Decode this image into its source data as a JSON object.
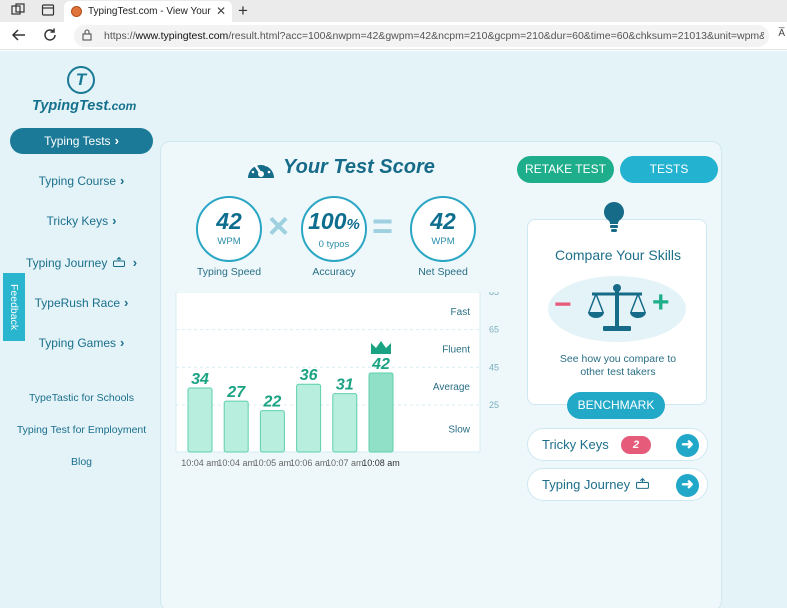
{
  "browser": {
    "tab_title": "TypingTest.com - View Your Typi",
    "tab_close": "✕",
    "new_tab": "+",
    "url_prefix": "https://",
    "url_host": "www.typingtest.com",
    "url_path": "/result.html?acc=100&nwpm=42&gwpm=42&ncpm=210&gcpm=210&dur=60&time=60&chksum=21013&unit=wpm&k...",
    "reader_icon": "A̅"
  },
  "logo": {
    "mark": "T",
    "name": "TypingTest",
    "suffix": ".com"
  },
  "sidebar": {
    "items": [
      {
        "label": "Typing Tests",
        "active": true
      },
      {
        "label": "Typing Course",
        "active": false
      },
      {
        "label": "Tricky Keys",
        "active": false
      },
      {
        "label": "Typing Journey",
        "active": false
      },
      {
        "label": "TypeRush Race",
        "active": false
      },
      {
        "label": "Typing Games",
        "active": false
      }
    ],
    "links": [
      "TypeTastic for Schools",
      "Typing Test for Employment",
      "Blog"
    ]
  },
  "feedback": {
    "label": "Feedback"
  },
  "score": {
    "title": "Your Test Score",
    "retake_label": "RETAKE TEST",
    "tests_label": "TESTS",
    "typing_speed": {
      "value": "42",
      "unit": "WPM",
      "label": "Typing Speed"
    },
    "accuracy": {
      "value": "100",
      "pct": "%",
      "unit": "0 typos",
      "label": "Accuracy"
    },
    "net_speed": {
      "value": "42",
      "unit": "WPM",
      "label": "Net Speed"
    }
  },
  "chart_data": {
    "type": "bar",
    "categories": [
      "10:04 am",
      "10:04 am",
      "10:05 am",
      "10:06 am",
      "10:07 am",
      "10:08 am"
    ],
    "values": [
      34,
      27,
      22,
      36,
      31,
      42
    ],
    "highlight_index": 5,
    "ylim": [
      0,
      85
    ],
    "y_ticks": [
      25,
      45,
      65,
      85
    ],
    "bands": [
      {
        "label": "Slow",
        "from": 0,
        "to": 25
      },
      {
        "label": "Average",
        "from": 25,
        "to": 45
      },
      {
        "label": "Fluent",
        "from": 45,
        "to": 65
      },
      {
        "label": "Fast",
        "from": 65,
        "to": 85
      }
    ],
    "colors": {
      "bar": "#b8eedd",
      "bar_border": "#5fcfae",
      "highlight": "#8fe0c6",
      "value": "#1aa383",
      "crown": "#1aa383"
    }
  },
  "compare": {
    "title": "Compare Your Skills",
    "minus": "−",
    "plus": "+",
    "description": "See how you compare to other test takers",
    "button_label": "BENCHMARK"
  },
  "tricky_keys": {
    "label": "Tricky Keys",
    "count": "2",
    "arrow": "➜"
  },
  "typing_journey": {
    "label": "Typing Journey",
    "arrow": "➜"
  },
  "colors": {
    "brand": "#166b88",
    "accent_green": "#1fae8c",
    "accent_blue": "#23b3d1",
    "badge": "#e75b7a"
  }
}
